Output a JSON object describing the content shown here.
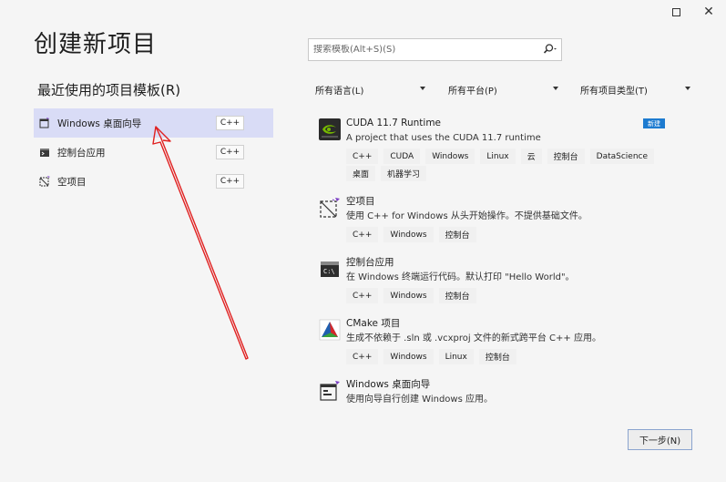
{
  "window": {
    "maximize_icon": "maximize-icon",
    "close_icon": "close-icon",
    "close_glyph": "✕"
  },
  "page": {
    "title": "创建新项目",
    "recent_title": "最近使用的项目模板(R)"
  },
  "recent": [
    {
      "label": "Windows 桌面向导",
      "tag": "C++",
      "icon": "desktop-wizard-icon",
      "selected": true
    },
    {
      "label": "控制台应用",
      "tag": "C++",
      "icon": "console-app-icon",
      "selected": false
    },
    {
      "label": "空项目",
      "tag": "C++",
      "icon": "empty-project-icon",
      "selected": false
    }
  ],
  "search": {
    "placeholder": "搜索模板(Alt+S)(S)",
    "icon": "search-icon"
  },
  "filters": {
    "language": "所有语言(L)",
    "platform": "所有平台(P)",
    "project_type": "所有项目类型(T)"
  },
  "templates": [
    {
      "name": "CUDA 11.7 Runtime",
      "desc": "A project that uses the CUDA 11.7 runtime",
      "badge": "新建",
      "icon": "nvidia-icon",
      "tags": [
        "C++",
        "CUDA",
        "Windows",
        "Linux",
        "云",
        "控制台",
        "DataScience",
        "桌面",
        "机器学习"
      ]
    },
    {
      "name": "空项目",
      "desc": "使用 C++ for Windows 从头开始操作。不提供基础文件。",
      "icon": "empty-project-icon",
      "tags": [
        "C++",
        "Windows",
        "控制台"
      ]
    },
    {
      "name": "控制台应用",
      "desc": "在 Windows 终端运行代码。默认打印 \"Hello World\"。",
      "icon": "console-app-icon",
      "tags": [
        "C++",
        "Windows",
        "控制台"
      ]
    },
    {
      "name": "CMake 项目",
      "desc": "生成不依赖于 .sln 或 .vcxproj 文件的新式跨平台 C++ 应用。",
      "icon": "cmake-icon",
      "tags": [
        "C++",
        "Windows",
        "Linux",
        "控制台"
      ]
    },
    {
      "name": "Windows 桌面向导",
      "desc": "使用向导自行创建 Windows 应用。",
      "icon": "desktop-wizard-icon",
      "tags": []
    }
  ],
  "footer": {
    "next_label": "下一步(N)"
  },
  "colors": {
    "selected_bg": "#d9dcf6",
    "badge_blue": "#1d7bd0",
    "annotation_red": "#e02020"
  }
}
